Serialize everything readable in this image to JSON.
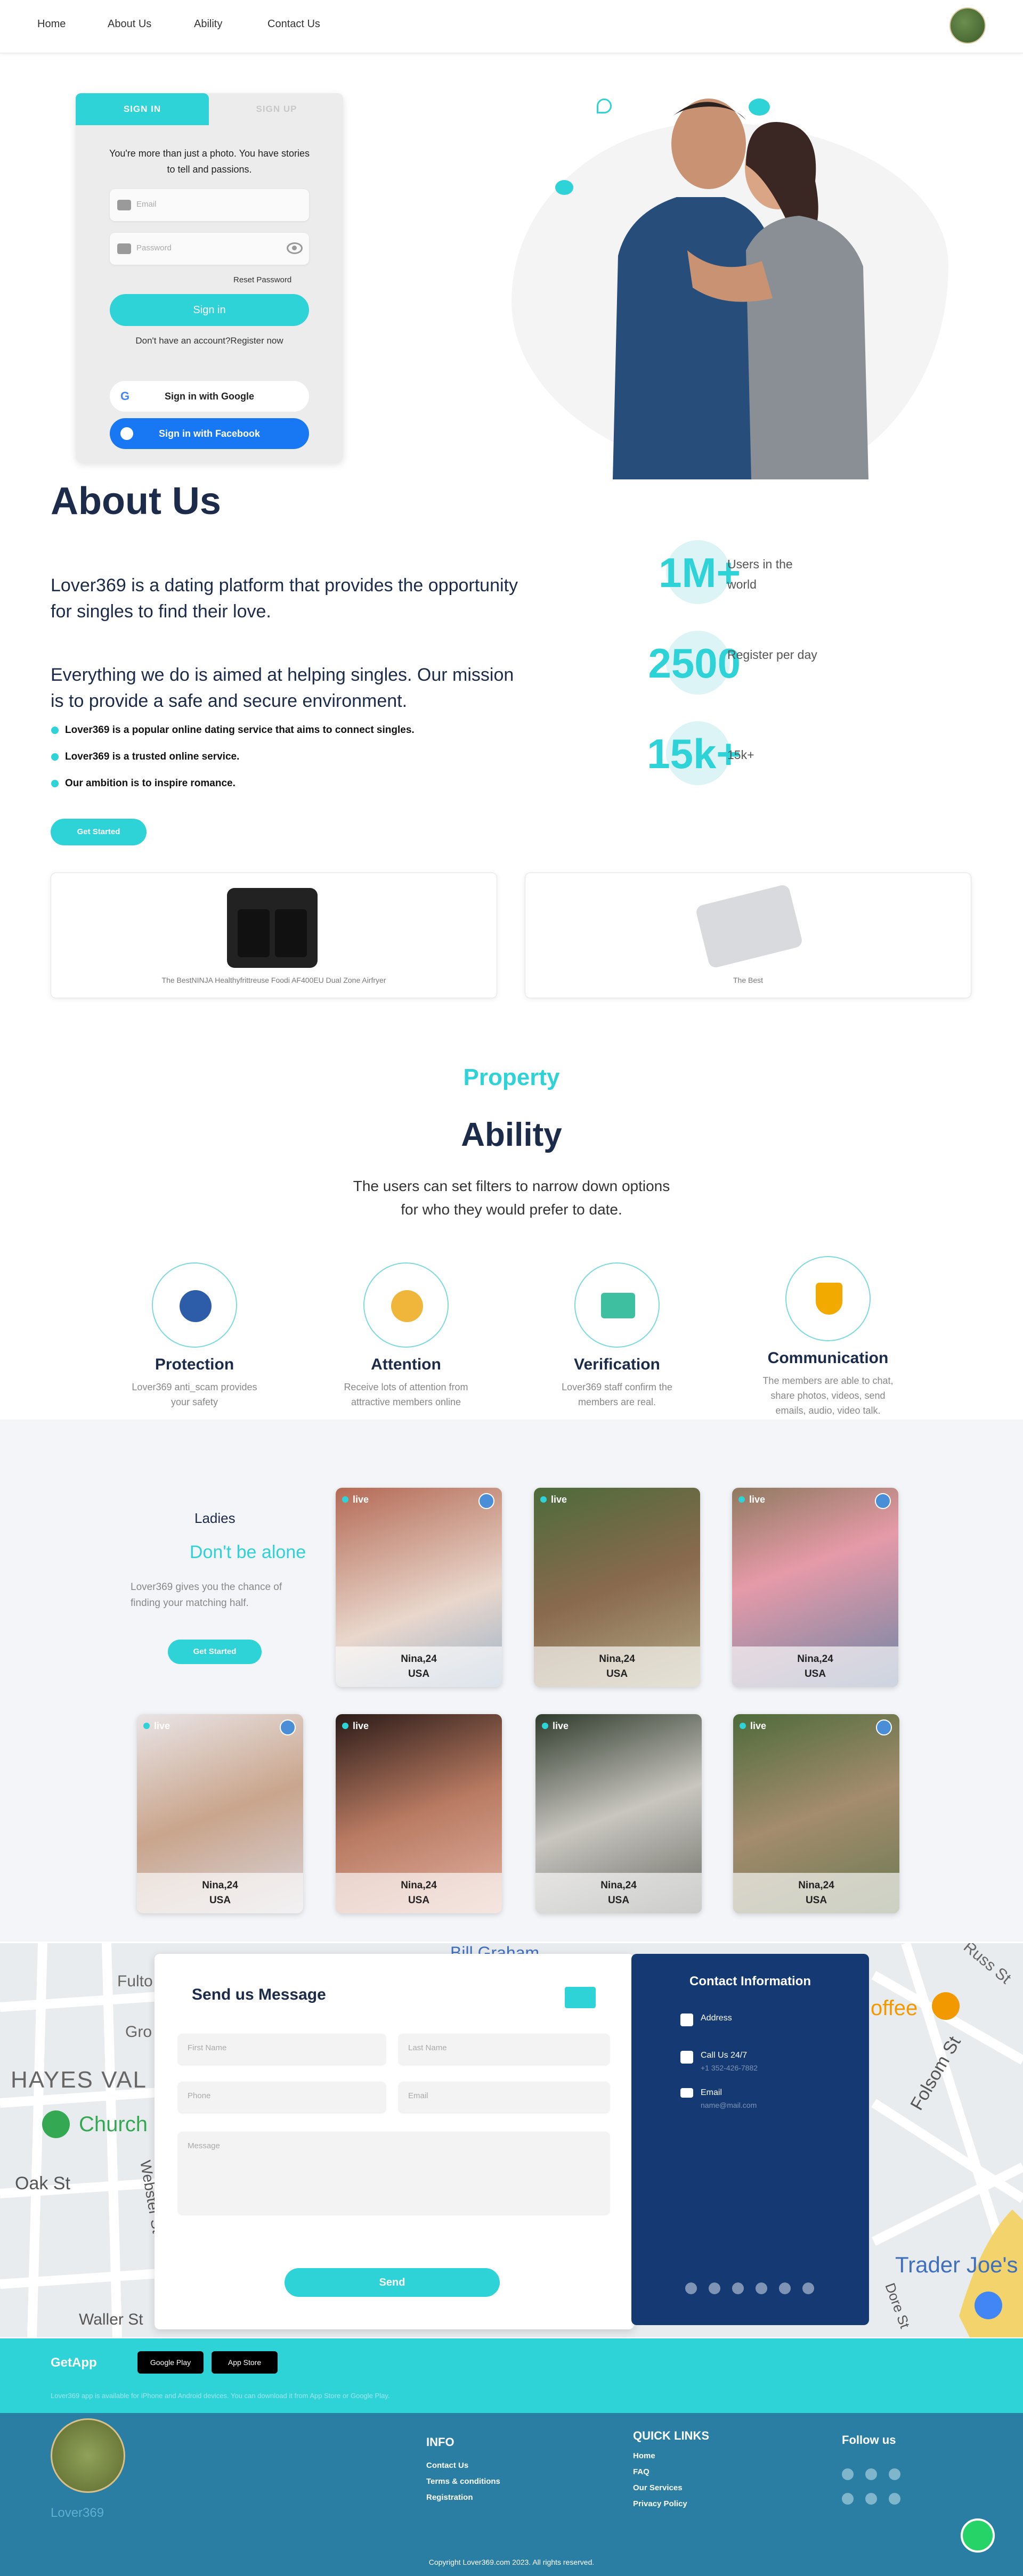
{
  "nav": {
    "items": [
      "Home",
      "About Us",
      "Ability",
      "Contact Us"
    ]
  },
  "signin": {
    "tab_in": "SIGN IN",
    "tab_up": "SIGN UP",
    "blurb": "You're more than just a photo. You have stories to tell and passions.",
    "email_placeholder": "Email",
    "password_placeholder": "Password",
    "reset": "Reset Password",
    "submit": "Sign in",
    "register": "Don't have an account?Register now",
    "google": "Sign in with Google",
    "facebook": "Sign in with Facebook"
  },
  "about": {
    "title": "About Us",
    "para1": "Lover369 is a dating platform that provides the opportunity for singles to find their love.",
    "para2": "Everything we do is aimed at helping singles. Our mission is to provide a safe and secure environment.",
    "bullets": [
      "Lover369 is a popular online dating service that aims to connect singles.",
      "Lover369 is a trusted online service.",
      "Our ambition is to inspire romance."
    ],
    "cta": "Get Started",
    "stats": [
      {
        "num": "1M+",
        "label": "Users in the world"
      },
      {
        "num": "2500",
        "label": "Register per day"
      },
      {
        "num": "15k+",
        "label": "15k+"
      }
    ]
  },
  "products": [
    {
      "caption": "The BestNINJA Healthyfrittreuse Foodi AF400EU Dual Zone Airfryer"
    },
    {
      "caption": "The Best"
    }
  ],
  "ability": {
    "kicker": "Property",
    "title": "Ability",
    "desc": "The users can set filters to narrow down options for who they would prefer to date.",
    "features": [
      {
        "title": "Protection",
        "desc": "Lover369 anti_scam provides your safety",
        "icon": "protection-icon"
      },
      {
        "title": "Attention",
        "desc": "Receive lots of attention from attractive members online",
        "icon": "attention-icon"
      },
      {
        "title": "Verification",
        "desc": "Lover369 staff confirm the members are real.",
        "icon": "verification-icon"
      },
      {
        "title": "Communication",
        "desc": "The members are able to chat, share photos, videos, send emails, audio, video talk.",
        "icon": "shield-check-icon"
      }
    ]
  },
  "members": {
    "kicker": "Ladies",
    "headline": "Don't be alone",
    "desc": "Lover369 gives you the chance of finding your matching half.",
    "cta": "Get Started",
    "cards": [
      {
        "live": "live",
        "name": "Nina,24",
        "country": "USA"
      },
      {
        "live": "live",
        "name": "Nina,24",
        "country": "USA"
      },
      {
        "live": "live",
        "name": "Nina,24",
        "country": "USA"
      },
      {
        "live": "live",
        "name": "Nina,24",
        "country": "USA"
      },
      {
        "live": "live",
        "name": "Nina,24",
        "country": "USA"
      },
      {
        "live": "live",
        "name": "Nina,24",
        "country": "USA"
      },
      {
        "live": "live",
        "name": "Nina,24",
        "country": "USA"
      }
    ]
  },
  "contact": {
    "title": "Send us Message",
    "first": "First Name",
    "last": "Last Name",
    "phone": "Phone",
    "email": "Email",
    "message": "Message",
    "send": "Send",
    "info_title": "Contact Information",
    "address_label": "Address",
    "call_label": "Call Us 24/7",
    "call_value": "+1 352-426-7882",
    "email_label": "Email",
    "email_value": "name@mail.com"
  },
  "map_labels": [
    "Bill Graham",
    "Fulto",
    "Gro",
    "HAYES VAL",
    "Church",
    "Oak St",
    "Webster St",
    "Waller St",
    "Russ St",
    "offee",
    "Folsom St",
    "Trader Joe's",
    "Dore St"
  ],
  "footer": {
    "getapp": "GetApp",
    "google_play": "Google Play",
    "app_store": "App Store",
    "app_note": "Lover369 app is available for iPhone and Android devices. You can download it from App Store or Google Play.",
    "brand": "Lover369",
    "info_title": "INFO",
    "info_links": [
      "Contact Us",
      "Terms & conditions",
      "Registration"
    ],
    "quick_title": "QUICK LINKS",
    "quick_links": [
      "Home",
      "FAQ",
      "Our Services",
      "Privacy Policy"
    ],
    "follow_title": "Follow us",
    "copyright": "Copyright Lover369.com 2023. All rights reserved."
  },
  "colors": {
    "accent": "#2ed3d8",
    "navy": "#1c2b4a",
    "panel": "#153a73",
    "footer": "#2b7ea3"
  }
}
